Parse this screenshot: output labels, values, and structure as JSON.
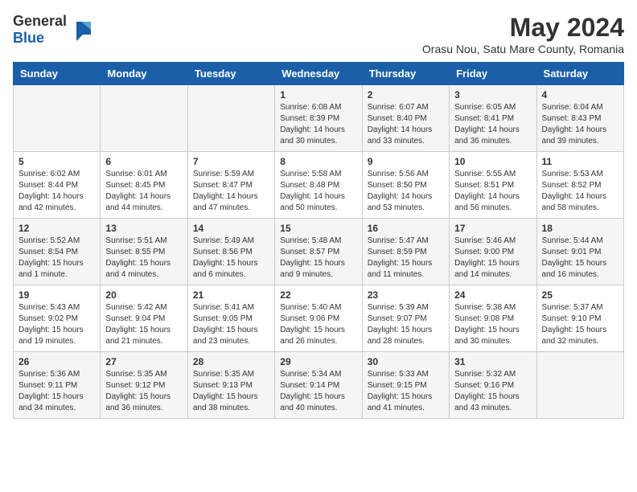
{
  "header": {
    "logo": {
      "general": "General",
      "blue": "Blue"
    },
    "title": "May 2024",
    "location": "Orasu Nou, Satu Mare County, Romania"
  },
  "days_of_week": [
    "Sunday",
    "Monday",
    "Tuesday",
    "Wednesday",
    "Thursday",
    "Friday",
    "Saturday"
  ],
  "weeks": [
    {
      "days": [
        {
          "number": "",
          "sunrise": "",
          "sunset": "",
          "daylight": ""
        },
        {
          "number": "",
          "sunrise": "",
          "sunset": "",
          "daylight": ""
        },
        {
          "number": "",
          "sunrise": "",
          "sunset": "",
          "daylight": ""
        },
        {
          "number": "1",
          "sunrise": "Sunrise: 6:08 AM",
          "sunset": "Sunset: 8:39 PM",
          "daylight": "Daylight: 14 hours and 30 minutes."
        },
        {
          "number": "2",
          "sunrise": "Sunrise: 6:07 AM",
          "sunset": "Sunset: 8:40 PM",
          "daylight": "Daylight: 14 hours and 33 minutes."
        },
        {
          "number": "3",
          "sunrise": "Sunrise: 6:05 AM",
          "sunset": "Sunset: 8:41 PM",
          "daylight": "Daylight: 14 hours and 36 minutes."
        },
        {
          "number": "4",
          "sunrise": "Sunrise: 6:04 AM",
          "sunset": "Sunset: 8:43 PM",
          "daylight": "Daylight: 14 hours and 39 minutes."
        }
      ]
    },
    {
      "days": [
        {
          "number": "5",
          "sunrise": "Sunrise: 6:02 AM",
          "sunset": "Sunset: 8:44 PM",
          "daylight": "Daylight: 14 hours and 42 minutes."
        },
        {
          "number": "6",
          "sunrise": "Sunrise: 6:01 AM",
          "sunset": "Sunset: 8:45 PM",
          "daylight": "Daylight: 14 hours and 44 minutes."
        },
        {
          "number": "7",
          "sunrise": "Sunrise: 5:59 AM",
          "sunset": "Sunset: 8:47 PM",
          "daylight": "Daylight: 14 hours and 47 minutes."
        },
        {
          "number": "8",
          "sunrise": "Sunrise: 5:58 AM",
          "sunset": "Sunset: 8:48 PM",
          "daylight": "Daylight: 14 hours and 50 minutes."
        },
        {
          "number": "9",
          "sunrise": "Sunrise: 5:56 AM",
          "sunset": "Sunset: 8:50 PM",
          "daylight": "Daylight: 14 hours and 53 minutes."
        },
        {
          "number": "10",
          "sunrise": "Sunrise: 5:55 AM",
          "sunset": "Sunset: 8:51 PM",
          "daylight": "Daylight: 14 hours and 56 minutes."
        },
        {
          "number": "11",
          "sunrise": "Sunrise: 5:53 AM",
          "sunset": "Sunset: 8:52 PM",
          "daylight": "Daylight: 14 hours and 58 minutes."
        }
      ]
    },
    {
      "days": [
        {
          "number": "12",
          "sunrise": "Sunrise: 5:52 AM",
          "sunset": "Sunset: 8:54 PM",
          "daylight": "Daylight: 15 hours and 1 minute."
        },
        {
          "number": "13",
          "sunrise": "Sunrise: 5:51 AM",
          "sunset": "Sunset: 8:55 PM",
          "daylight": "Daylight: 15 hours and 4 minutes."
        },
        {
          "number": "14",
          "sunrise": "Sunrise: 5:49 AM",
          "sunset": "Sunset: 8:56 PM",
          "daylight": "Daylight: 15 hours and 6 minutes."
        },
        {
          "number": "15",
          "sunrise": "Sunrise: 5:48 AM",
          "sunset": "Sunset: 8:57 PM",
          "daylight": "Daylight: 15 hours and 9 minutes."
        },
        {
          "number": "16",
          "sunrise": "Sunrise: 5:47 AM",
          "sunset": "Sunset: 8:59 PM",
          "daylight": "Daylight: 15 hours and 11 minutes."
        },
        {
          "number": "17",
          "sunrise": "Sunrise: 5:46 AM",
          "sunset": "Sunset: 9:00 PM",
          "daylight": "Daylight: 15 hours and 14 minutes."
        },
        {
          "number": "18",
          "sunrise": "Sunrise: 5:44 AM",
          "sunset": "Sunset: 9:01 PM",
          "daylight": "Daylight: 15 hours and 16 minutes."
        }
      ]
    },
    {
      "days": [
        {
          "number": "19",
          "sunrise": "Sunrise: 5:43 AM",
          "sunset": "Sunset: 9:02 PM",
          "daylight": "Daylight: 15 hours and 19 minutes."
        },
        {
          "number": "20",
          "sunrise": "Sunrise: 5:42 AM",
          "sunset": "Sunset: 9:04 PM",
          "daylight": "Daylight: 15 hours and 21 minutes."
        },
        {
          "number": "21",
          "sunrise": "Sunrise: 5:41 AM",
          "sunset": "Sunset: 9:05 PM",
          "daylight": "Daylight: 15 hours and 23 minutes."
        },
        {
          "number": "22",
          "sunrise": "Sunrise: 5:40 AM",
          "sunset": "Sunset: 9:06 PM",
          "daylight": "Daylight: 15 hours and 26 minutes."
        },
        {
          "number": "23",
          "sunrise": "Sunrise: 5:39 AM",
          "sunset": "Sunset: 9:07 PM",
          "daylight": "Daylight: 15 hours and 28 minutes."
        },
        {
          "number": "24",
          "sunrise": "Sunrise: 5:38 AM",
          "sunset": "Sunset: 9:08 PM",
          "daylight": "Daylight: 15 hours and 30 minutes."
        },
        {
          "number": "25",
          "sunrise": "Sunrise: 5:37 AM",
          "sunset": "Sunset: 9:10 PM",
          "daylight": "Daylight: 15 hours and 32 minutes."
        }
      ]
    },
    {
      "days": [
        {
          "number": "26",
          "sunrise": "Sunrise: 5:36 AM",
          "sunset": "Sunset: 9:11 PM",
          "daylight": "Daylight: 15 hours and 34 minutes."
        },
        {
          "number": "27",
          "sunrise": "Sunrise: 5:35 AM",
          "sunset": "Sunset: 9:12 PM",
          "daylight": "Daylight: 15 hours and 36 minutes."
        },
        {
          "number": "28",
          "sunrise": "Sunrise: 5:35 AM",
          "sunset": "Sunset: 9:13 PM",
          "daylight": "Daylight: 15 hours and 38 minutes."
        },
        {
          "number": "29",
          "sunrise": "Sunrise: 5:34 AM",
          "sunset": "Sunset: 9:14 PM",
          "daylight": "Daylight: 15 hours and 40 minutes."
        },
        {
          "number": "30",
          "sunrise": "Sunrise: 5:33 AM",
          "sunset": "Sunset: 9:15 PM",
          "daylight": "Daylight: 15 hours and 41 minutes."
        },
        {
          "number": "31",
          "sunrise": "Sunrise: 5:32 AM",
          "sunset": "Sunset: 9:16 PM",
          "daylight": "Daylight: 15 hours and 43 minutes."
        },
        {
          "number": "",
          "sunrise": "",
          "sunset": "",
          "daylight": ""
        }
      ]
    }
  ]
}
